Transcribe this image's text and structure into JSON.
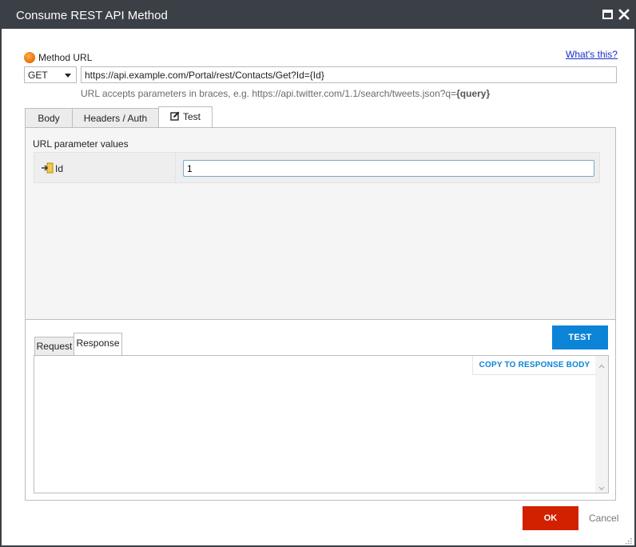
{
  "window": {
    "title": "Consume REST API Method",
    "maximize_icon": "maximize-icon",
    "close_icon": "close-icon"
  },
  "method": {
    "label": "Method URL",
    "status_icon": "orange-dot-icon",
    "whats_this": "What's this?",
    "verb": "GET",
    "url": "https://api.example.com/Portal/rest/Contacts/Get?Id={Id}",
    "hint_prefix": "URL accepts parameters in braces, e.g. https://api.twitter.com/1.1/search/tweets.json?q=",
    "hint_param": "{query}"
  },
  "tabs": [
    {
      "label": "Body",
      "active": false
    },
    {
      "label": "Headers / Auth",
      "active": false
    },
    {
      "label": "Test",
      "active": true,
      "icon": "edit-icon"
    }
  ],
  "test_panel": {
    "params_title": "URL parameter values",
    "params": [
      {
        "name": "Id",
        "value": "1",
        "icon": "parameter-input-icon"
      }
    ],
    "sub_tabs": [
      {
        "label": "Request",
        "active": false
      },
      {
        "label": "Response",
        "active": true
      }
    ],
    "test_button": "TEST",
    "copy_button": "COPY TO RESPONSE BODY",
    "response_text": ""
  },
  "footer": {
    "ok": "OK",
    "cancel": "Cancel"
  },
  "colors": {
    "titlebar": "#3b4046",
    "primary_blue": "#0b84d8",
    "ok_red": "#d12100",
    "link": "#1a2ecb",
    "status_orange": "#f07a10"
  }
}
